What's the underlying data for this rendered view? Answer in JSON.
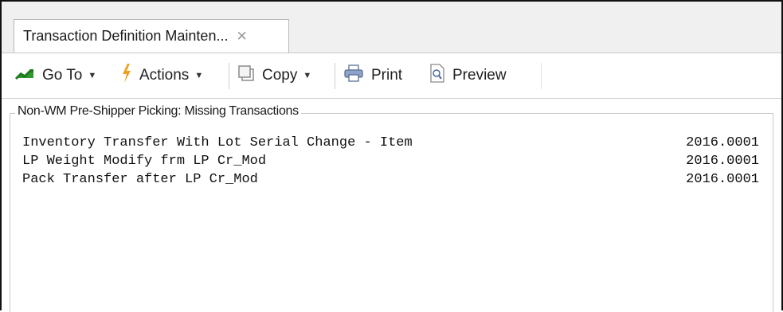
{
  "tab": {
    "label": "Transaction Definition Mainten...",
    "close_glyph": "✕"
  },
  "toolbar": {
    "goto_label": "Go To",
    "actions_label": "Actions",
    "copy_label": "Copy",
    "print_label": "Print",
    "preview_label": "Preview",
    "dropdown_glyph": "▼"
  },
  "group": {
    "title": "Non-WM Pre-Shipper Picking: Missing Transactions"
  },
  "transactions": [
    {
      "name": "Inventory Transfer With Lot Serial Change - Item",
      "version": "2016.0001"
    },
    {
      "name": "LP Weight Modify frm LP Cr_Mod",
      "version": "2016.0001"
    },
    {
      "name": "Pack Transfer after LP Cr_Mod",
      "version": "2016.0001"
    }
  ],
  "icons": {
    "goto": "goto-arrow-icon",
    "actions": "lightning-icon",
    "copy": "copy-icon",
    "print": "printer-icon",
    "preview": "preview-icon"
  },
  "colors": {
    "goto_icon": "#2e9a2e",
    "actions_icon": "#f0a020",
    "tab_close": "#9a9a9a"
  }
}
